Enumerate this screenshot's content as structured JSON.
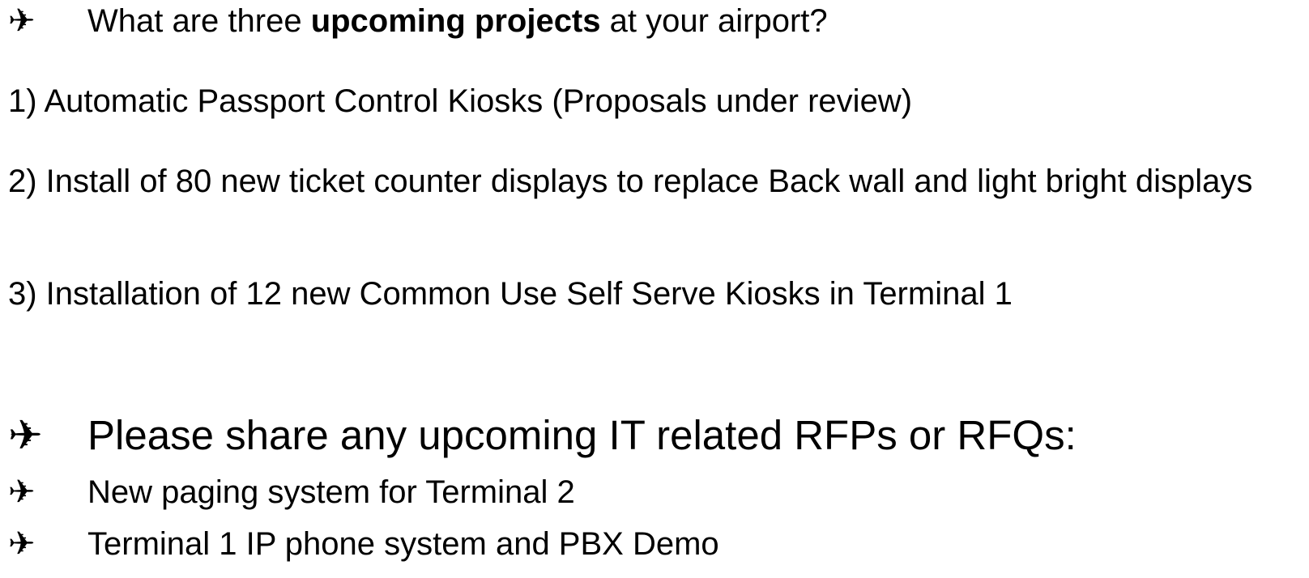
{
  "bullet_glyph": "✈",
  "question": {
    "prefix": "What are three ",
    "bold": "upcoming projects",
    "suffix": " at your airport?"
  },
  "projects": [
    "1)  Automatic Passport Control Kiosks (Proposals under review)",
    "2) Install of 80 new ticket counter displays to replace Back wall and light bright displays",
    "3) Installation of 12 new Common Use Self Serve Kiosks in Terminal 1"
  ],
  "rfp_heading": "Please share any upcoming IT related RFPs or RFQs:",
  "rfp_items": [
    "New paging system for Terminal 2",
    "Terminal 1 IP phone system and PBX Demo"
  ]
}
